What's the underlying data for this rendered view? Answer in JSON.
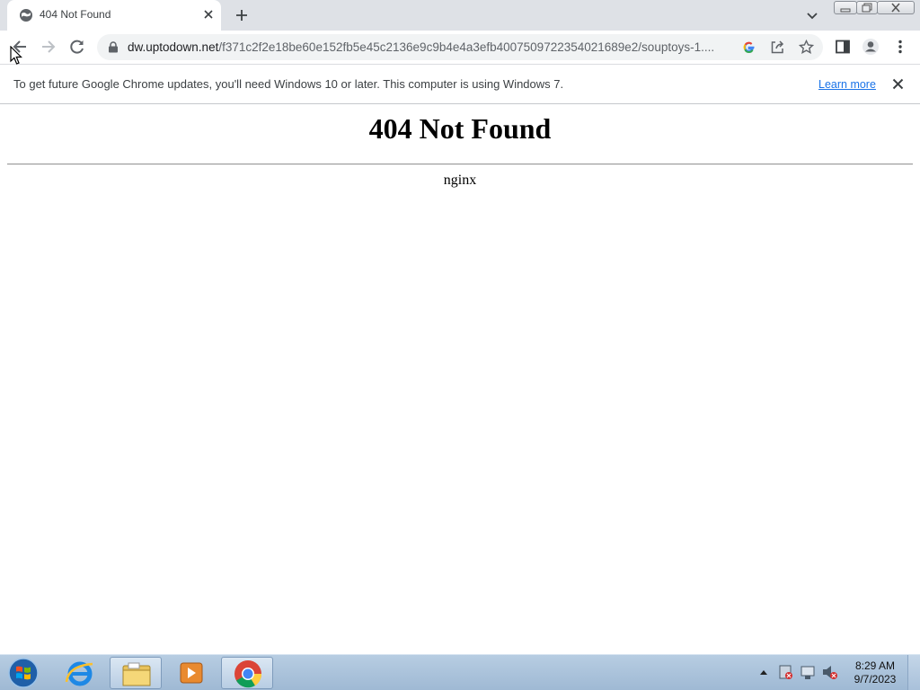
{
  "browser": {
    "tab": {
      "title": "404 Not Found"
    },
    "omnibox": {
      "url_host": "dw.uptodown.net",
      "url_path": "/f371c2f2e18be60e152fb5e45c2136e9c9b4e4a3efb4007509722354021689e2/souptoys-1...."
    },
    "infobar": {
      "message": "To get future Google Chrome updates, you'll need Windows 10 or later. This computer is using Windows 7.",
      "link_label": "Learn more"
    }
  },
  "page": {
    "heading": "404 Not Found",
    "server": "nginx"
  },
  "taskbar": {
    "time": "8:29 AM",
    "date": "9/7/2023"
  },
  "icons": [
    "globe-icon",
    "close-icon",
    "plus-icon",
    "chevron-down-icon",
    "back-icon",
    "forward-icon",
    "reload-icon",
    "lock-icon",
    "google-icon",
    "share-icon",
    "star-icon",
    "side-panel-icon",
    "profile-icon",
    "menu-icon",
    "windows-start-icon",
    "ie-icon",
    "explorer-icon",
    "media-player-icon",
    "chrome-icon"
  ],
  "colors": {
    "tabstrip": "#dee1e6",
    "omnibox": "#f1f3f4",
    "link": "#1a73e8",
    "taskbar": "#b7cde2"
  }
}
